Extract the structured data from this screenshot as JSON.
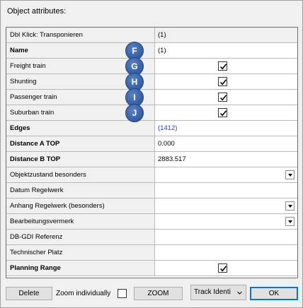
{
  "dialog": {
    "title": "Object attributes:"
  },
  "rows": [
    {
      "label": "Dbl Klick: Transponieren",
      "value": "(1)",
      "bold": false,
      "kind": "text",
      "header": true
    },
    {
      "label": "Name",
      "value": "(1)",
      "bold": true,
      "kind": "text",
      "badge": "F"
    },
    {
      "label": "Freight train",
      "bold": false,
      "kind": "check",
      "checked": true,
      "badge": "G"
    },
    {
      "label": "Shunting",
      "bold": false,
      "kind": "check",
      "checked": true,
      "badge": "H"
    },
    {
      "label": "Passenger train",
      "bold": false,
      "kind": "check",
      "checked": true,
      "badge": "I"
    },
    {
      "label": "Suburban train",
      "bold": false,
      "kind": "check",
      "checked": true,
      "badge": "J"
    },
    {
      "label": "Edges",
      "value": "(1412)",
      "bold": true,
      "kind": "link"
    },
    {
      "label": "Distance A TOP",
      "value": "0.000",
      "bold": true,
      "kind": "text"
    },
    {
      "label": "Distance B TOP",
      "value": "2883.517",
      "bold": true,
      "kind": "text"
    },
    {
      "label": "Objektzustand besonders",
      "bold": false,
      "kind": "dropdown"
    },
    {
      "label": "Datum Regelwerk",
      "bold": false,
      "kind": "text",
      "value": ""
    },
    {
      "label": "Anhang Regelwerk (besonders)",
      "bold": false,
      "kind": "dropdown"
    },
    {
      "label": "Bearbeitungsvermerk",
      "bold": false,
      "kind": "dropdown"
    },
    {
      "label": "DB-GDI Referenz",
      "bold": false,
      "kind": "text",
      "value": ""
    },
    {
      "label": "Technischer Platz",
      "bold": false,
      "kind": "text",
      "value": ""
    },
    {
      "label": "Planning Range",
      "bold": true,
      "kind": "check",
      "checked": true
    }
  ],
  "footer": {
    "delete_label": "Delete",
    "zoom_individually_label": "Zoom individually",
    "zoom_label": "ZOOM",
    "track_select_value": "Track Identi",
    "ok_label": "OK"
  },
  "colors": {
    "link": "#1a3fd1",
    "badge": "#3a64a8",
    "ok_border": "#0078d7"
  }
}
